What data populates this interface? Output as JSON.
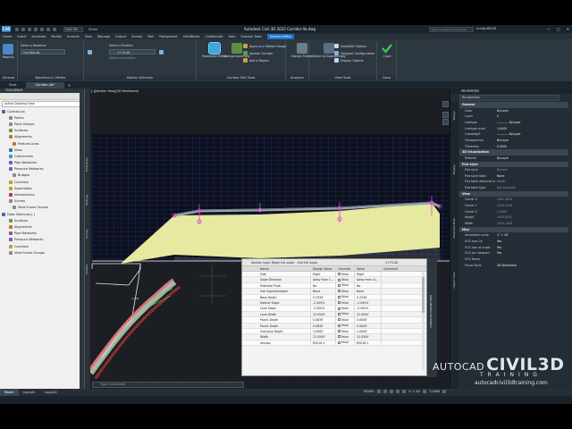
{
  "titlebar": {
    "logo": "C3D",
    "workspace": "Civil 3D",
    "share": "Share",
    "title": "Autodesk Civil 3D 2022   Corridor-4a.dwg",
    "search_placeholder": "Type a keyword or phrase",
    "user": "kcnight8108",
    "win_min": "—",
    "win_max": "□",
    "win_close": "✕"
  },
  "ribbon_tabs": [
    "Home",
    "Insert",
    "Annotate",
    "Modify",
    "Analyze",
    "View",
    "Manage",
    "Output",
    "Survey",
    "Rail",
    "Transparent",
    "InfraWorks",
    "Collaborate",
    "Help",
    "Express Tools",
    "Section Editor"
  ],
  "ribbon_active_tab": "Section Editor",
  "ribbon": {
    "general": {
      "title": "General",
      "button": "Reports"
    },
    "baseline": {
      "title": "Baselines & Offsets",
      "label": "Select a Baseline:",
      "value": "Corridor-4a"
    },
    "station": {
      "title": "Station Selection",
      "label": "Select a Station:",
      "value": "1+75.00",
      "increment_label": "Station increment"
    },
    "corridor_edit": {
      "title": "Corridor Edit Tools",
      "btn1": "Parameter Editor",
      "btn2": "Change Assembly",
      "item1": "Apply to a Station Range",
      "item2": "Update Corridor",
      "item3": "Add a Region"
    },
    "analyzer": {
      "title": "Analyzer",
      "btn": "Station Tracker"
    },
    "view_tools": {
      "title": "View Tools",
      "btn": "Zoom to Subassembly",
      "item1": "View/Edit Options",
      "item2": "Viewport Configuration",
      "item3": "Display Objects"
    },
    "close": {
      "title": "Close",
      "btn": "Close"
    }
  },
  "doc_tabs": [
    "Start",
    "Corridor-4a*"
  ],
  "doc_active": "Corridor-4a*",
  "toolspace": {
    "title": "TOOLSPACE",
    "view": "Active Drawing View",
    "items": [
      {
        "label": "Corridor-4a",
        "indent": 0,
        "color": "#3b6fb0"
      },
      {
        "label": "Points",
        "indent": 2,
        "color": "#8a8a8a"
      },
      {
        "label": "Point Groups",
        "indent": 2,
        "color": "#8a8a8a"
      },
      {
        "label": "Surfaces",
        "indent": 2,
        "color": "#6a9a3a"
      },
      {
        "label": "Alignments",
        "indent": 2,
        "color": "#c0782a"
      },
      {
        "label": "Feature Lines",
        "indent": 3,
        "color": "#c0782a"
      },
      {
        "label": "Sites",
        "indent": 2,
        "color": "#3b6fb0"
      },
      {
        "label": "Catchments",
        "indent": 2,
        "color": "#3b9ab0"
      },
      {
        "label": "Pipe Networks",
        "indent": 2,
        "color": "#7a5ab0"
      },
      {
        "label": "Pressure Networks",
        "indent": 2,
        "color": "#7a5ab0"
      },
      {
        "label": "Bridges",
        "indent": 3,
        "color": "#8a8a8a"
      },
      {
        "label": "Corridors",
        "indent": 2,
        "color": "#c0a02a"
      },
      {
        "label": "Assemblies",
        "indent": 2,
        "color": "#c0a02a"
      },
      {
        "label": "Intersections",
        "indent": 2,
        "color": "#b03b3b"
      },
      {
        "label": "Survey",
        "indent": 2,
        "color": "#8a8a8a"
      },
      {
        "label": "View Frame Groups",
        "indent": 3,
        "color": "#8a8a8a"
      },
      {
        "label": "Data Shortcuts [ ]",
        "indent": 0,
        "color": "#3b6fb0"
      },
      {
        "label": "Surfaces",
        "indent": 2,
        "color": "#6a9a3a"
      },
      {
        "label": "Alignments",
        "indent": 2,
        "color": "#c0782a"
      },
      {
        "label": "Pipe Networks",
        "indent": 2,
        "color": "#7a5ab0"
      },
      {
        "label": "Pressure Networks",
        "indent": 2,
        "color": "#7a5ab0"
      },
      {
        "label": "Corridors",
        "indent": 2,
        "color": "#c0a02a"
      },
      {
        "label": "View Frame Groups",
        "indent": 2,
        "color": "#8a8a8a"
      }
    ],
    "side_tabs": [
      "Prospector",
      "Settings",
      "Survey",
      "Toolbox"
    ]
  },
  "viewport": {
    "label": "[-][Section View][2D Wireframe]"
  },
  "props_editor": {
    "title": "Section type: Begin full super - End full super",
    "station": "1+75.00",
    "side_label": "CORRIDOR PARAMETERS",
    "headers": [
      "Name",
      "Design Value",
      "Override",
      "Value",
      "Comment"
    ],
    "rows": [
      {
        "name": "Side",
        "design": "Right",
        "override": "False",
        "value": "Right"
      },
      {
        "name": "Slope Direction",
        "design": "Away from C...",
        "override": "False",
        "value": "Away from Cr..."
      },
      {
        "name": "Potential Pivot",
        "design": "No",
        "override": "False",
        "value": "No"
      },
      {
        "name": "Use Superelevation",
        "design": "None",
        "override": "False",
        "value": "None"
      },
      {
        "name": "Base Depth",
        "design": "0.3330'",
        "override": "False",
        "value": "0.3330'"
      },
      {
        "name": "Default Slope",
        "design": "-2.000%",
        "override": "False",
        "value": "-2.000%"
      },
      {
        "name": "Lane Slope",
        "design": "-2.000%",
        "override": "False",
        "value": "-2.000%"
      },
      {
        "name": "Lane Width",
        "design": "12.0000'",
        "override": "False",
        "value": "12.0000'"
      },
      {
        "name": "Pave1 Depth",
        "design": "0.0830'",
        "override": "False",
        "value": "0.0830'"
      },
      {
        "name": "Pave2 Depth",
        "design": "0.0830'",
        "override": "False",
        "value": "0.0830'"
      },
      {
        "name": "Sub-base Depth",
        "design": "1.0000'",
        "override": "False",
        "value": "1.0000'"
      },
      {
        "name": "Width",
        "design": "12.0000'",
        "override": "False",
        "value": "12.0000'"
      },
      {
        "name": "Version",
        "design": "R2018.1",
        "override": "False",
        "value": "R2018.1"
      }
    ]
  },
  "command_line": {
    "placeholder": "Type a command"
  },
  "properties": {
    "title": "PROPERTIES",
    "selection": "No selection",
    "categories": [
      {
        "name": "General",
        "rows": [
          {
            "k": "Color",
            "v": "ByLayer"
          },
          {
            "k": "Layer",
            "v": "0"
          },
          {
            "k": "Linetype",
            "v": "———— ByLayer"
          },
          {
            "k": "Linetype scale",
            "v": "1.0000"
          },
          {
            "k": "Lineweight",
            "v": "———— ByLayer"
          },
          {
            "k": "Transparency",
            "v": "ByLayer"
          },
          {
            "k": "Thickness",
            "v": "0.0000"
          }
        ]
      },
      {
        "name": "3D Visualization",
        "rows": [
          {
            "k": "Material",
            "v": "ByLayer"
          }
        ]
      },
      {
        "name": "Plot style",
        "rows": [
          {
            "k": "Plot style",
            "v": "ByColor",
            "dim": true
          },
          {
            "k": "Plot style table",
            "v": "None"
          },
          {
            "k": "Plot table attached to",
            "v": "Model",
            "dim": true
          },
          {
            "k": "Plot table type",
            "v": "Not available",
            "dim": true
          }
        ]
      },
      {
        "name": "View",
        "rows": [
          {
            "k": "Center X",
            "v": "4361.5829",
            "dim": true
          },
          {
            "k": "Center Y",
            "v": "4330.9149",
            "dim": true
          },
          {
            "k": "Center Z",
            "v": "0.0000",
            "dim": true
          },
          {
            "k": "Height",
            "v": "1435.8791",
            "dim": true
          },
          {
            "k": "Width",
            "v": "3474.1456",
            "dim": true
          }
        ]
      },
      {
        "name": "Misc",
        "rows": [
          {
            "k": "Annotation scale",
            "v": "1\" = 40'"
          },
          {
            "k": "UCS icon On",
            "v": "Yes"
          },
          {
            "k": "UCS icon at origin",
            "v": "Yes"
          },
          {
            "k": "UCS per viewport",
            "v": "Yes"
          },
          {
            "k": "UCS Name",
            "v": ""
          },
          {
            "k": "Visual Style",
            "v": "2D Wireframe"
          }
        ]
      }
    ],
    "side_tabs": [
      "Design",
      "Display",
      "Extended Data",
      "Object Class"
    ]
  },
  "status_tabs": [
    "Model",
    "Layout1",
    "Layout2"
  ],
  "status_active": "Model",
  "status_right": {
    "model": "MODEL",
    "scale": "1\" = 40'",
    "zoom": "3.5000"
  },
  "watermark": {
    "autocad": "AUTOCAD",
    "civil": "CIVIL3D",
    "training": "TRAINING",
    "url": "autocadcivil3dtraining.com"
  },
  "colors": {
    "accent": "#1a73c9",
    "section_fill": "#f2f6a6",
    "section_grid": "#1f2fd8",
    "pavement": "#aab3bc",
    "points": "#e23bd2",
    "corridor_red": "#ff3b3b"
  }
}
